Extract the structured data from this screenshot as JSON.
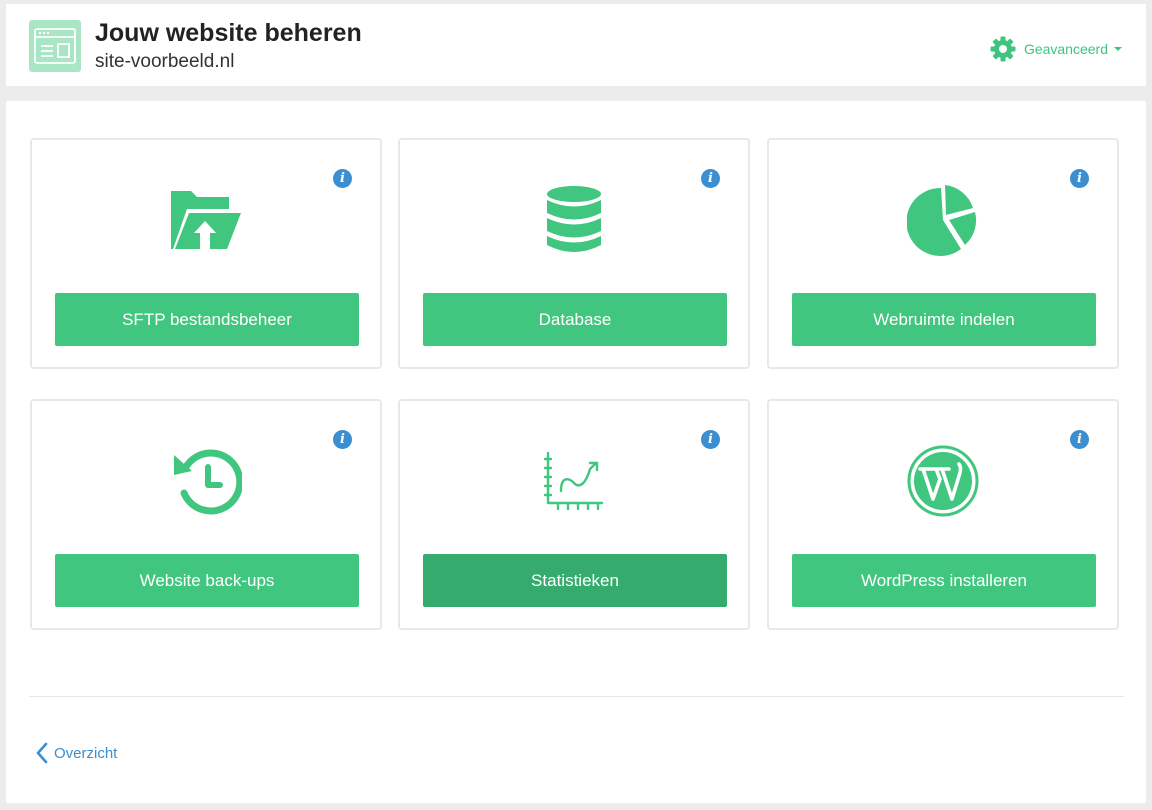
{
  "header": {
    "title": "Jouw website beheren",
    "domain": "site-voorbeeld.nl",
    "logo_icon": "website-icon",
    "advanced_label": "Geavanceerd",
    "advanced_icon": "gear-icon"
  },
  "cards": [
    {
      "label": "SFTP bestandsbeheer",
      "icon": "folder-upload-icon",
      "info": "i"
    },
    {
      "label": "Database",
      "icon": "database-icon",
      "info": "i"
    },
    {
      "label": "Webruimte indelen",
      "icon": "pie-chart-icon",
      "info": "i"
    },
    {
      "label": "Website back-ups",
      "icon": "history-icon",
      "info": "i"
    },
    {
      "label": "Statistieken",
      "icon": "line-chart-icon",
      "info": "i"
    },
    {
      "label": "WordPress installeren",
      "icon": "wordpress-icon",
      "info": "i"
    }
  ],
  "footer": {
    "back_label": "Overzicht",
    "back_icon": "chevron-left-icon"
  },
  "colors": {
    "accent": "#41c67f",
    "accent_active": "#35ac6e",
    "info": "#3b8ed0",
    "link": "#3b8ed0"
  }
}
